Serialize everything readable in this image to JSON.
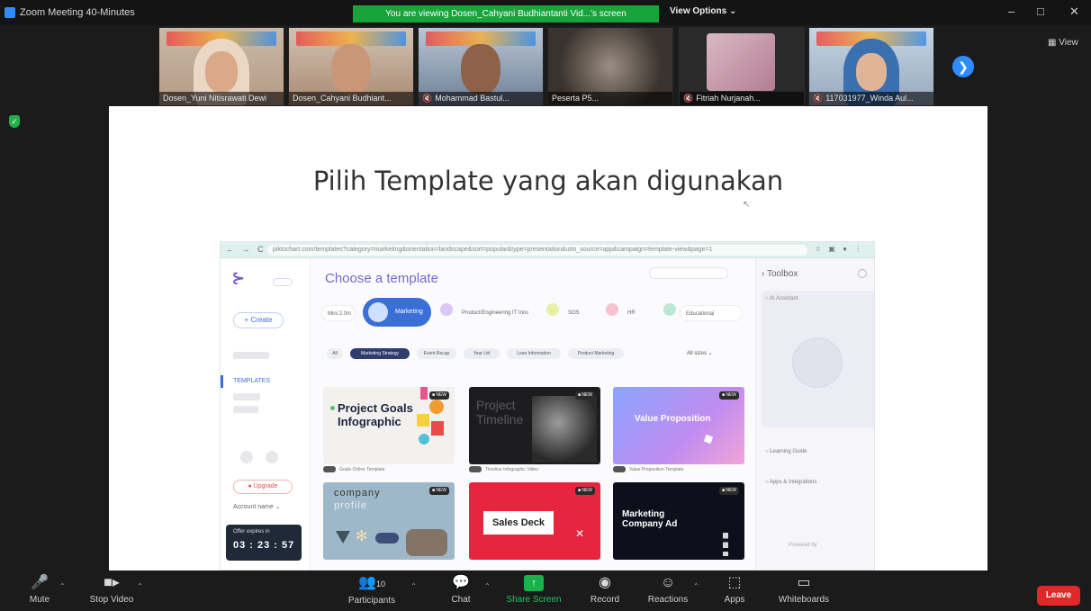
{
  "window": {
    "title": "Zoom Meeting 40-Minutes",
    "share_banner": "You are viewing Dosen_Cahyani Budhiantanti Vid...'s screen",
    "view_options": "View Options ⌄",
    "minimize": "–",
    "maximize": "□",
    "close": "✕"
  },
  "participants": [
    {
      "name": "Dosen_Yuni Nitisrawati Dewi",
      "muted": false
    },
    {
      "name": "Dosen_Cahyani Budhiant...",
      "muted": false
    },
    {
      "name": "Mohammad Bastul...",
      "muted": true
    },
    {
      "name": "Peserta P5...",
      "muted": false
    },
    {
      "name": "Fitriah Nurjanah...",
      "muted": true
    },
    {
      "name": "117031977_Winda Aul...",
      "muted": true
    }
  ],
  "strip": {
    "next_icon": "❯",
    "view_label": "View"
  },
  "slide": {
    "title": "Pilih Template yang akan digunakan",
    "browser": {
      "nav": "← → C",
      "url": "piktochart.com/templates?category=marketing&orientation=landscape&sort=popular&type=presentation&utm_source=app&campaign=template-view&page=1",
      "ext": "☆ ▣ ● ⋮",
      "app": {
        "logo": "⊱",
        "create_label": "+ Create",
        "active_nav": "TEMPLATES",
        "upgrade_label": "● Upgrade",
        "account_label": "Account name ⌄",
        "timer_label": "Offer expires in",
        "timer_value": "03 : 23 : 57",
        "page_title": "Choose a template",
        "categories": [
          {
            "label": "Mini 2.0m"
          },
          {
            "label": "Marketing"
          },
          {
            "label": "Product/Engineering IT Innovation"
          },
          {
            "label": "SOS"
          },
          {
            "label": "HR"
          },
          {
            "label": "Educational"
          }
        ],
        "filters": [
          "All",
          "Marketing Strategy",
          "Event Recap",
          "Year Ltd",
          "Lean Information",
          "Product Marketing"
        ],
        "sort_label": "All sizes ⌄",
        "cards": [
          {
            "title": "Project Goals Infographic",
            "badge": "■ NEW",
            "caption": "Goals Online Template"
          },
          {
            "title": "Project Timeline",
            "badge": "■ NEW",
            "caption": "Timeline Infographic Video"
          },
          {
            "title": "Value Proposition",
            "badge": "■ NEW",
            "caption": "Value Proposition Template"
          },
          {
            "title_line1": "company",
            "title_line2": "profile",
            "badge": "■ NEW"
          },
          {
            "title": "Sales Deck",
            "badge": "■ NEW",
            "close_icon": "✕"
          },
          {
            "title": "Marketing Company Ad",
            "badge": "■ NEW"
          }
        ],
        "toolbox": {
          "title": "Toolbox",
          "ai_label": "AI Assistant",
          "links": [
            "Learning Guide",
            "Apps & Integrations"
          ],
          "powered": "Powered by"
        }
      }
    }
  },
  "toolbar": {
    "mute": "Mute",
    "stop_video": "Stop Video",
    "participants": "Participants",
    "participants_count": "10",
    "chat": "Chat",
    "share_screen": "Share Screen",
    "record": "Record",
    "reactions": "Reactions",
    "apps": "Apps",
    "whiteboards": "Whiteboards",
    "leave": "Leave"
  }
}
